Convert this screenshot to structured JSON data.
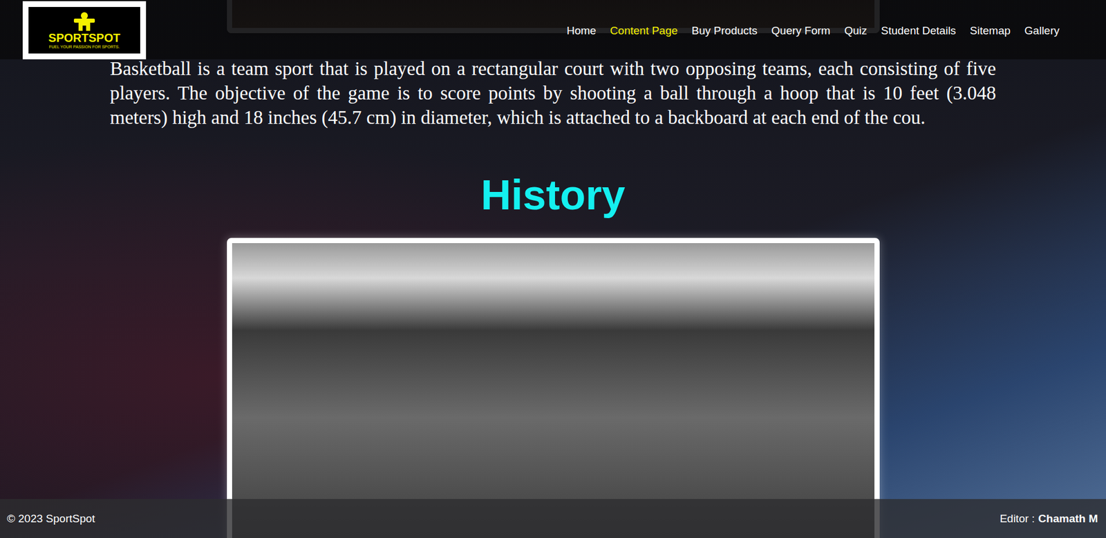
{
  "logo": {
    "name": "SPORTSPOT",
    "tagline": "FUEL YOUR PASSION FOR SPORTS."
  },
  "nav": [
    {
      "label": "Home",
      "selected": false
    },
    {
      "label": "Content Page",
      "selected": true
    },
    {
      "label": "Buy Products",
      "selected": false
    },
    {
      "label": "Query Form",
      "selected": false
    },
    {
      "label": "Quiz",
      "selected": false
    },
    {
      "label": "Student Details",
      "selected": false
    },
    {
      "label": "Sitemap",
      "selected": false
    },
    {
      "label": "Gallery",
      "selected": false
    }
  ],
  "intro": "Basketball is a team sport that is played on a rectangular court with two opposing teams, each consisting of five players. The objective of the game is to score points by shooting a ball through a hoop that is 10 feet (3.048 meters) high and 18 inches (45.7 cm) in diameter, which is attached to a backboard at each end of the cou.",
  "history_heading": "History",
  "footer": {
    "copyright": "© 2023 SportSpot",
    "editor_label": "Editor :",
    "editor_name": "Chamath M"
  }
}
